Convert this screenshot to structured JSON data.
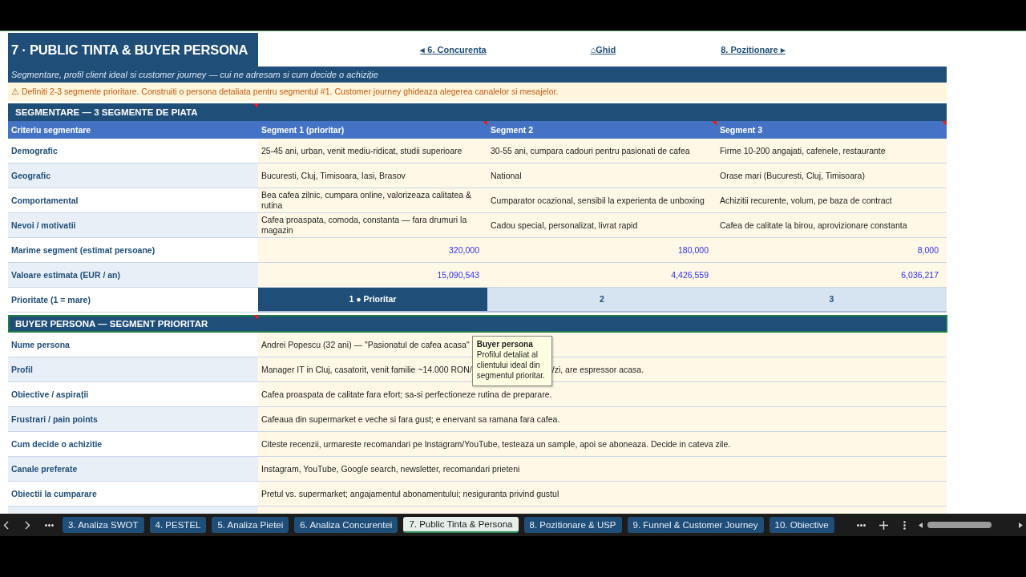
{
  "title": "7 · PUBLIC TINTA & BUYER PERSONA",
  "nav_links": [
    "◂ 6. Concurenta",
    "⌂Ghid",
    "8. Pozitionare ▸"
  ],
  "subtitle": "Segmentare, profil client ideal si customer journey — cui ne adresam si cum decide o achiziție",
  "notice": "⚠ Definiti 2-3 segmente prioritare. Construiti o persona detaliata pentru segmentul #1. Customer journey ghideaza alegerea canalelor si mesajelor.",
  "segmentation": {
    "title": "SEGMENTARE — 3 SEGMENTE DE PIATA",
    "comment": true,
    "columns": [
      {
        "label": "Criteriu segmentare",
        "comment": false
      },
      {
        "label": "Segment 1 (prioritar)",
        "comment": true
      },
      {
        "label": "Segment 2",
        "comment": true
      },
      {
        "label": "Segment 3",
        "comment": true
      }
    ],
    "rows": [
      {
        "label": "Demografic",
        "kind": "text",
        "cells": [
          "25-45 ani, urban, venit mediu-ridicat, studii superioare",
          "30-55 ani, cumpara cadouri pentru pasionati de cafea",
          "Firme 10-200 angajati, cafenele, restaurante"
        ]
      },
      {
        "label": "Geografic",
        "kind": "text",
        "cells": [
          "Bucuresti, Cluj, Timisoara, Iasi, Brasov",
          "National",
          "Orase mari (Bucuresti, Cluj, Timisoara)"
        ]
      },
      {
        "label": "Comportamental",
        "kind": "text",
        "cells": [
          "Bea cafea zilnic, cumpara online, valorizeaza calitatea & rutina",
          "Cumparator ocazional, sensibil la experienta de unboxing",
          "Achizitii recurente, volum, pe baza de contract"
        ]
      },
      {
        "label": "Nevoi / motivatii",
        "kind": "text",
        "cells": [
          "Cafea proaspata, comoda, constanta — fara drumuri la magazin",
          "Cadou special, personalizat, livrat rapid",
          "Cafea de calitate la birou, aprovizionare constanta"
        ]
      },
      {
        "label": "Marime segment (estimat persoane)",
        "kind": "number",
        "cells": [
          "320,000",
          "180,000",
          "8,000"
        ]
      },
      {
        "label": "Valoare estimata (EUR / an)",
        "kind": "number",
        "cells": [
          "15,090,543",
          "4,426,559",
          "6,036,217"
        ]
      },
      {
        "label": "Prioritate (1 = mare)",
        "kind": "priority",
        "cells": [
          {
            "text": "1 ● Prioritar",
            "selected": true
          },
          {
            "text": "2",
            "selected": false
          },
          {
            "text": "3",
            "selected": false
          }
        ]
      }
    ]
  },
  "persona": {
    "title": "BUYER PERSONA — SEGMENT PRIORITAR",
    "comment": true,
    "selected": true,
    "rows": [
      {
        "label": "Nume persona",
        "kind": "text",
        "value": "Andrei Popescu (32 ani) — \"Pasionatul de cafea acasa\""
      },
      {
        "label": "Profil",
        "kind": "covered",
        "value": "Manager IT in Cluj, casatorit, venit familie ~14.000 RON/",
        "value_after": "/zi, are espressor acasa."
      },
      {
        "label": "Obiective / aspirații",
        "kind": "text",
        "value": "Cafea proaspata de calitate fara efort; sa-si perfectioneze rutina de preparare."
      },
      {
        "label": "Frustrari / pain points",
        "kind": "text",
        "value": "Cafeaua din supermarket e veche si fara gust; e enervant sa ramana fara cafea."
      },
      {
        "label": "Cum decide o achizitie",
        "kind": "text",
        "value": "Citeste recenzii, urmareste recomandari pe Instagram/YouTube, testeaza un sample, apoi se aboneaza. Decide in cateva zile."
      },
      {
        "label": "Canale preferate",
        "kind": "text",
        "value": "Instagram, YouTube, Google search, newsletter, recomandari prieteni"
      },
      {
        "label": "Obiectii la cumparare",
        "kind": "text",
        "value": "Pretul vs. supermarket; angajamentul abonamentului; nesiguranta privind gustul"
      }
    ],
    "comment_tooltip": {
      "title": "Buyer persona",
      "text": "Profilul detaliat al clientului ideal din segmentul prioritar."
    }
  },
  "sheet_tabs": [
    {
      "label": "3. Analiza SWOT",
      "selected": false
    },
    {
      "label": "4. PESTEL",
      "selected": false
    },
    {
      "label": "5. Analiza Pietei",
      "selected": false
    },
    {
      "label": "6. Analiza Concurentei",
      "selected": false
    },
    {
      "label": "7. Public Tinta & Persona",
      "selected": true
    },
    {
      "label": "8. Pozitionare & USP",
      "selected": false
    },
    {
      "label": "9. Funnel & Customer Journey",
      "selected": false
    },
    {
      "label": "10. Obiective",
      "selected": false
    }
  ]
}
